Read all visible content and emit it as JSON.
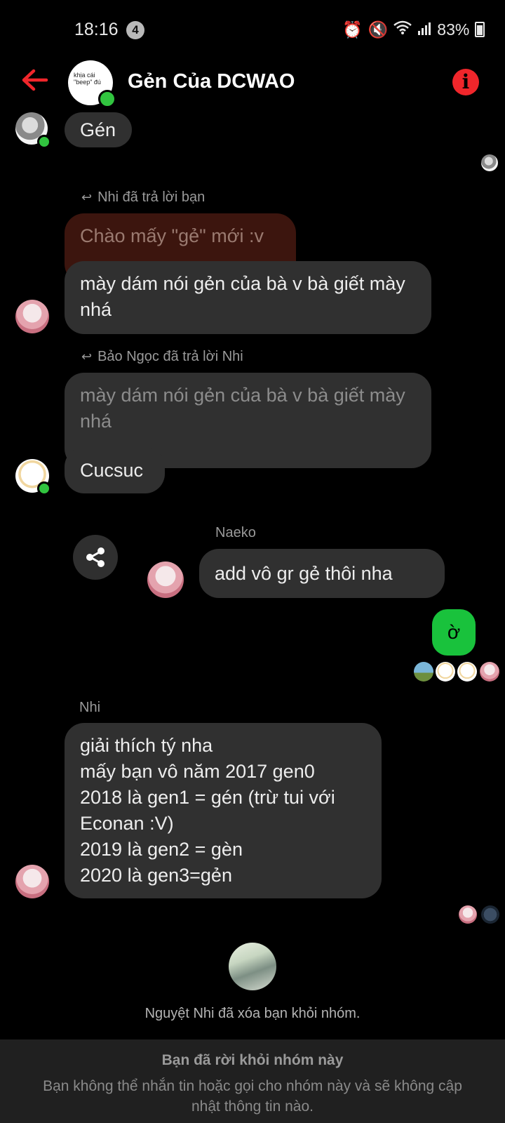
{
  "status_bar": {
    "time": "18:16",
    "notif_count": "4",
    "battery": "83%"
  },
  "header": {
    "title": "Gẻn Của DCWAO",
    "avatar_caption": "khịa cái \"beep\" đú"
  },
  "messages": {
    "m1": {
      "text": "Gén"
    },
    "reply1": {
      "label": "Nhi đã trả lời bạn",
      "quoted": "Chào mấy \"gẻ\" mới :v",
      "text": "mày dám nói gẻn của bà v bà giết mày nhá"
    },
    "reply2": {
      "label": "Bảo Ngọc đã trả lời Nhi",
      "quoted": "mày dám nói gẻn của bà v bà giết mày nhá",
      "text": "Cucsuc"
    },
    "naeko": {
      "sender": "Naeko",
      "text": "add vô gr gẻ thôi nha"
    },
    "mine": {
      "text": "ờ"
    },
    "nhi": {
      "sender": "Nhi",
      "lines": [
        "giải thích tý nha",
        "mấy bạn vô năm 2017 gen0",
        "2018 là gen1 = gén (trừ tui với",
        "Econan :V)",
        "2019 là gen2 = gèn",
        "2020 là gen3=gẻn"
      ]
    }
  },
  "system_message": "Nguyệt Nhi đã xóa bạn khỏi nhóm.",
  "footer": {
    "title": "Bạn đã rời khỏi nhóm này",
    "subtitle": "Bạn không thể nhắn tin hoặc gọi cho nhóm này và sẽ không cập nhật thông tin nào."
  },
  "colors": {
    "accent_red": "#f0262b",
    "my_bubble": "#19c23c",
    "online": "#31c43f"
  }
}
